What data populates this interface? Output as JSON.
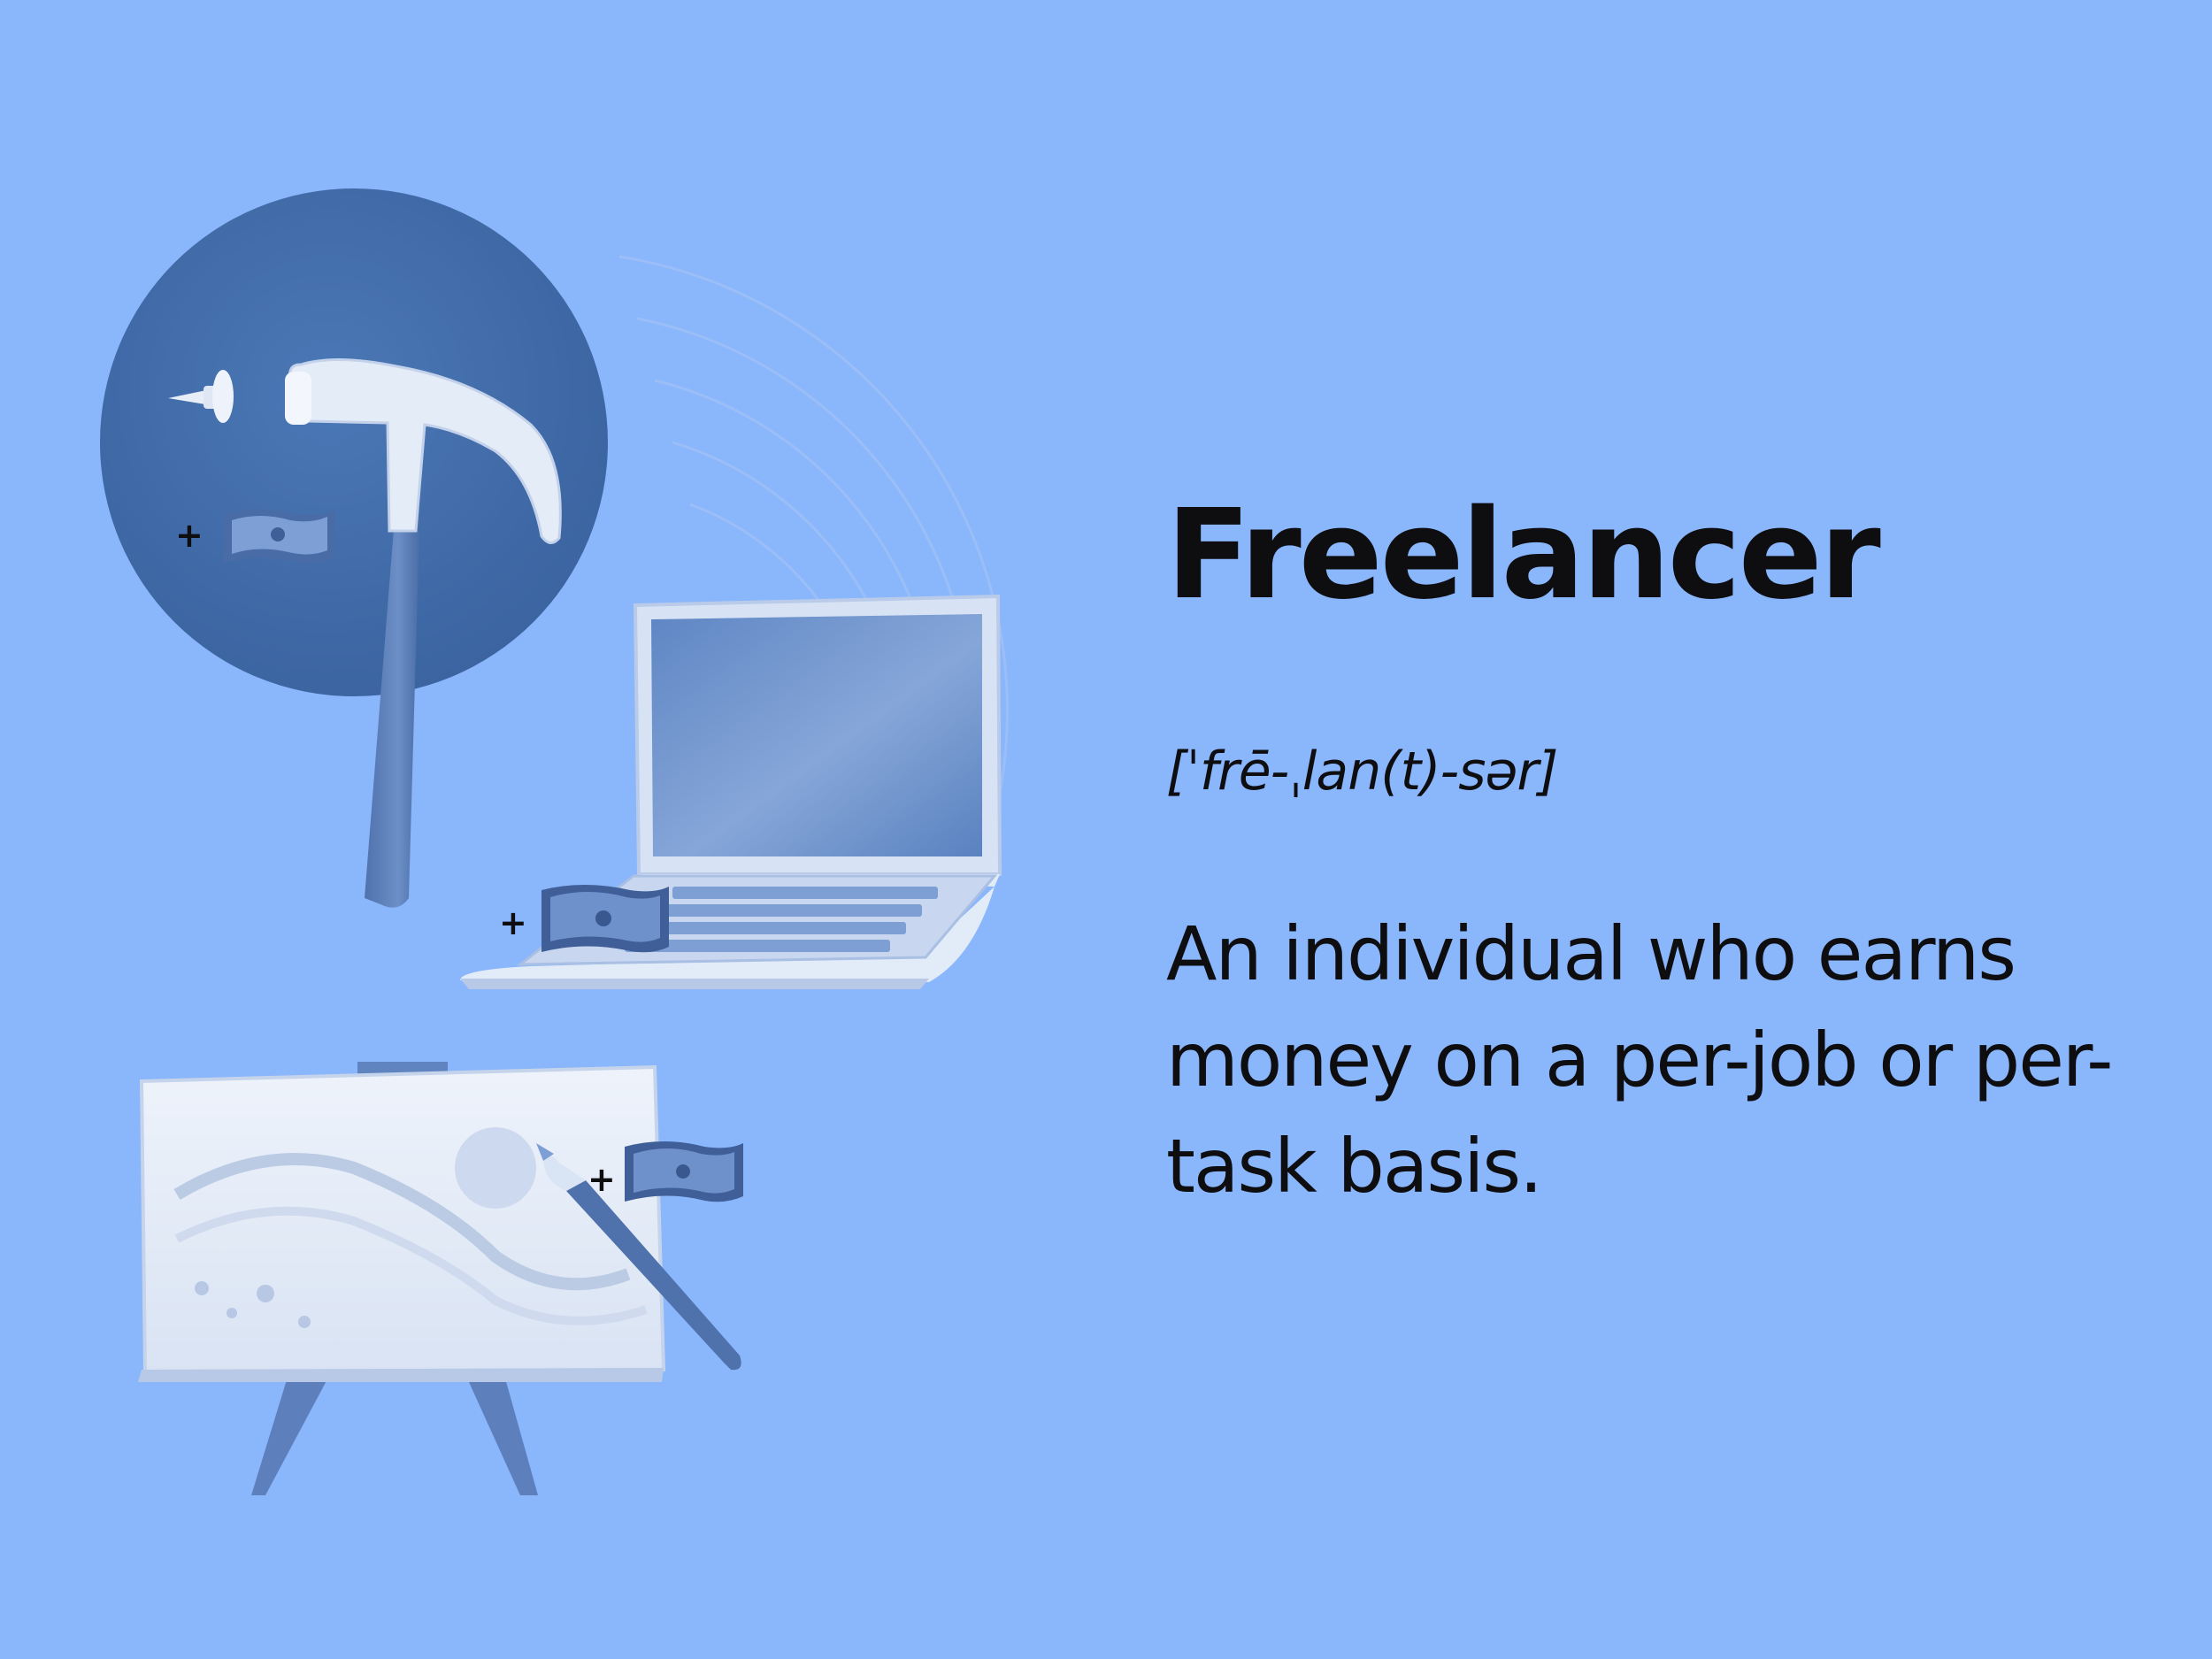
{
  "colors": {
    "background": "#8ab6fb",
    "circle": "#3f6aa8",
    "text": "#0e0e10",
    "accent_light": "#dde7f6",
    "accent_dark": "#4d6fa8"
  },
  "definition_card": {
    "term": "Freelancer",
    "pronunciation": "[ˈfrē-ˌlan(t)-sər]",
    "definition": "An individual who earns money on a per-job or per-task basis."
  },
  "illustration": {
    "icons": [
      "hammer-icon",
      "nail-icon",
      "laptop-icon",
      "canvas-easel-icon",
      "paintbrush-icon",
      "money-icon"
    ],
    "plus_symbol": "+"
  }
}
